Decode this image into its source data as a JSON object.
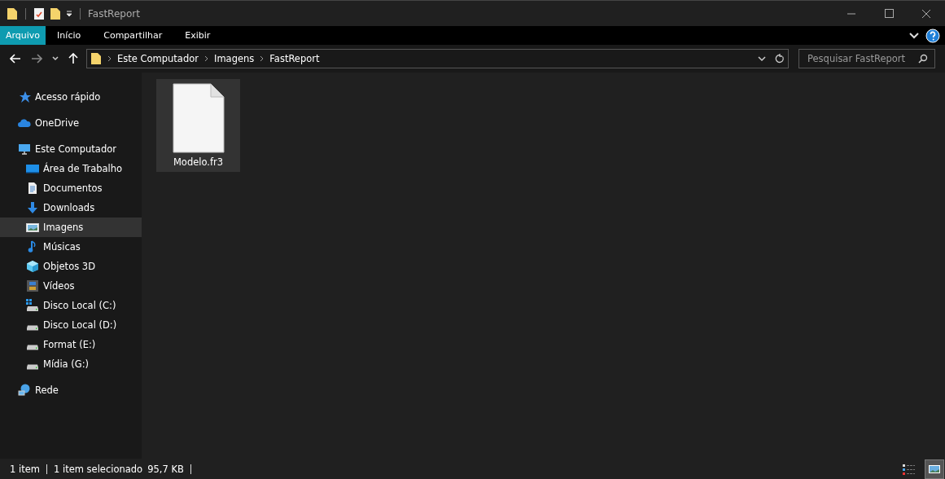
{
  "window": {
    "title": "FastReport"
  },
  "ribbon_tabs": [
    {
      "label": "Arquivo",
      "selected": true
    },
    {
      "label": "Início",
      "selected": false
    },
    {
      "label": "Compartilhar",
      "selected": false
    },
    {
      "label": "Exibir",
      "selected": false
    }
  ],
  "address_bar": {
    "path": [
      "Este Computador",
      "Imagens",
      "FastReport"
    ]
  },
  "search": {
    "placeholder": "Pesquisar FastReport"
  },
  "sidebar": {
    "items": [
      {
        "label": "Acesso rápido",
        "kind": "star",
        "selected": false
      },
      {
        "label": "OneDrive",
        "kind": "cloud",
        "selected": false
      },
      {
        "label": "Este Computador",
        "kind": "computer",
        "selected": false,
        "children": [
          {
            "label": "Área de Trabalho",
            "kind": "desktop",
            "selected": false
          },
          {
            "label": "Documentos",
            "kind": "document",
            "selected": false
          },
          {
            "label": "Downloads",
            "kind": "download",
            "selected": false
          },
          {
            "label": "Imagens",
            "kind": "pictures",
            "selected": true
          },
          {
            "label": "Músicas",
            "kind": "music",
            "selected": false
          },
          {
            "label": "Objetos 3D",
            "kind": "cube",
            "selected": false
          },
          {
            "label": "Vídeos",
            "kind": "video",
            "selected": false
          },
          {
            "label": "Disco Local (C:)",
            "kind": "systemdrive",
            "selected": false
          },
          {
            "label": "Disco Local (D:)",
            "kind": "drive",
            "selected": false
          },
          {
            "label": "Format (E:)",
            "kind": "drive",
            "selected": false
          },
          {
            "label": "Mídia (G:)",
            "kind": "drive",
            "selected": false
          }
        ]
      },
      {
        "label": "Rede",
        "kind": "network",
        "selected": false
      }
    ]
  },
  "files": [
    {
      "name": "Modelo.fr3",
      "selected": true
    }
  ],
  "status_bar": {
    "item_count": "1 item",
    "selection": "1 item selecionado",
    "size": "95,7 KB"
  },
  "view_buttons": [
    {
      "kind": "details",
      "selected": false
    },
    {
      "kind": "large_icons",
      "selected": true
    }
  ]
}
